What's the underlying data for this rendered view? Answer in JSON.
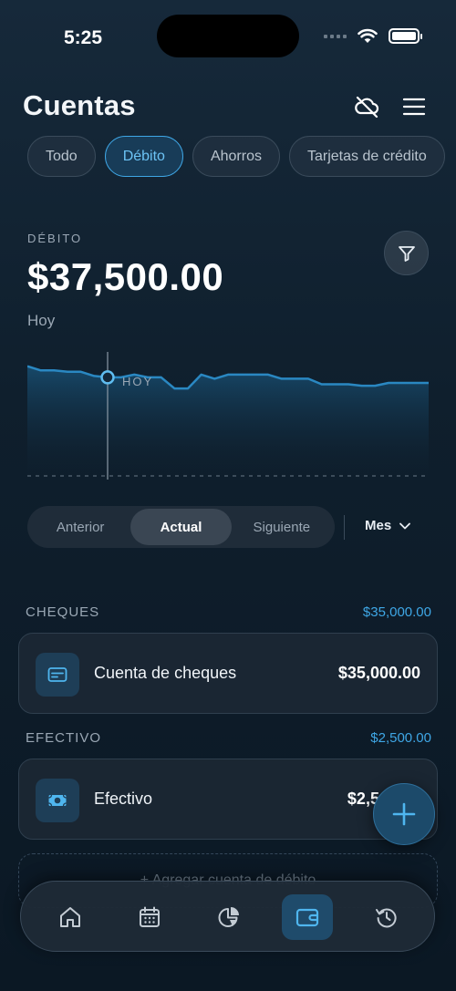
{
  "status_bar": {
    "time": "5:25"
  },
  "header": {
    "title": "Cuentas",
    "cloud_icon": "cloud-off-icon",
    "menu_icon": "hamburger-menu-icon"
  },
  "filters": {
    "chips": [
      {
        "label": "Todo",
        "active": false
      },
      {
        "label": "Débito",
        "active": true
      },
      {
        "label": "Ahorros",
        "active": false
      },
      {
        "label": "Tarjetas de crédito",
        "active": false
      }
    ]
  },
  "summary": {
    "section_label": "DÉBITO",
    "balance": "$37,500.00",
    "date_label": "Hoy",
    "filter_icon": "funnel-icon"
  },
  "chart_data": {
    "type": "line",
    "marker_label": "HOY",
    "values": [
      37.9,
      37.6,
      37.6,
      37.5,
      37.5,
      37.2,
      37.1,
      37.1,
      37.3,
      37.1,
      37.1,
      36.3,
      36.3,
      37.3,
      37.0,
      37.3,
      37.3,
      37.3,
      37.3,
      37.0,
      37.0,
      37.0,
      36.6,
      36.6,
      36.6,
      36.5,
      36.5,
      36.7,
      36.7,
      36.7,
      36.7
    ],
    "marker_index": 6,
    "ylim": [
      30,
      39
    ]
  },
  "period": {
    "segments": [
      {
        "label": "Anterior",
        "active": false
      },
      {
        "label": "Actual",
        "active": true
      },
      {
        "label": "Siguiente",
        "active": false
      }
    ],
    "range_label": "Mes"
  },
  "groups": [
    {
      "name": "CHEQUES",
      "total": "$35,000.00",
      "account": {
        "name": "Cuenta de cheques",
        "balance": "$35,000.00",
        "icon": "credit-card-icon"
      }
    },
    {
      "name": "EFECTIVO",
      "total": "$2,500.00",
      "account": {
        "name": "Efectivo",
        "balance": "$2,500.00",
        "icon": "banknote-icon"
      }
    }
  ],
  "add_account": {
    "label": "+ Agregar cuenta de débito"
  },
  "fab": {
    "icon": "plus-icon"
  },
  "tabbar": {
    "tabs": [
      {
        "icon": "home-icon",
        "active": false
      },
      {
        "icon": "calendar-icon",
        "active": false
      },
      {
        "icon": "pie-chart-icon",
        "active": false
      },
      {
        "icon": "wallet-icon",
        "active": true
      },
      {
        "icon": "history-icon",
        "active": false
      }
    ]
  },
  "colors": {
    "accent": "#3fa7e6",
    "background": "#0f1f2d"
  }
}
